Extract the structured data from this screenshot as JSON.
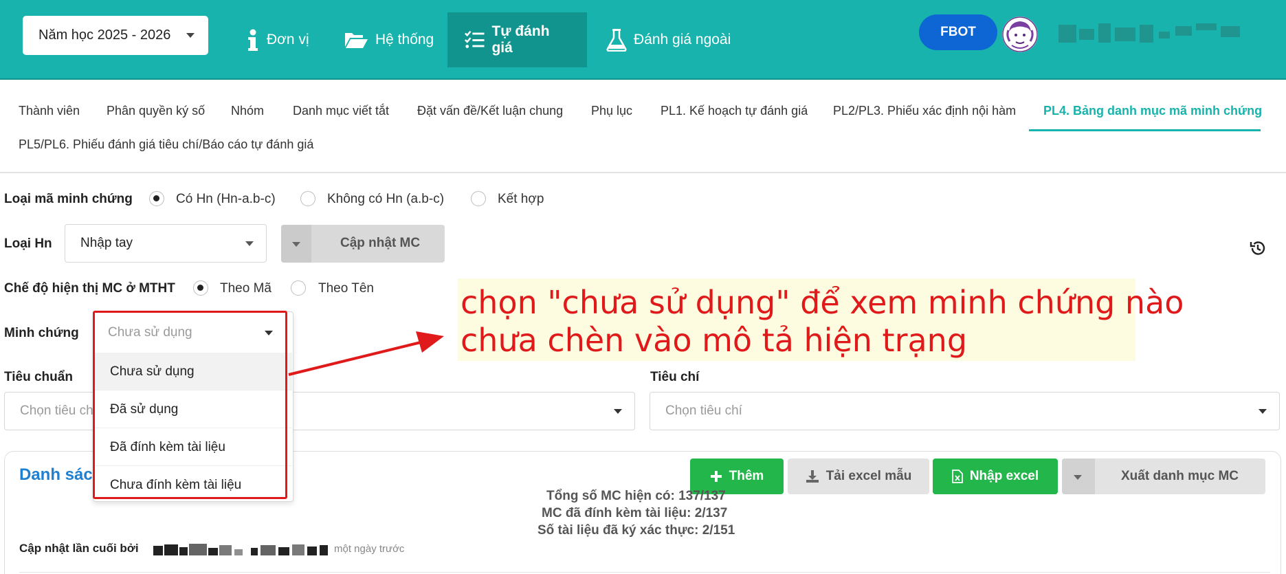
{
  "navbar": {
    "year_select": "Năm học 2025 - 2026",
    "items": [
      {
        "label": "Đơn vị",
        "icon": "info-icon"
      },
      {
        "label": "Hệ thống",
        "icon": "folder-open-icon"
      },
      {
        "label": "Tự đánh giá",
        "icon": "checklist-icon",
        "active": true
      },
      {
        "label": "Đánh giá ngoài",
        "icon": "flask-icon"
      }
    ],
    "user_button": "FBOT"
  },
  "tabs": [
    "Thành viên",
    "Phân quyền ký số",
    "Nhóm",
    "Danh mục viết tắt",
    "Đặt vấn đề/Kết luận chung",
    "Phụ lục",
    "PL1. Kế hoạch tự đánh giá",
    "PL2/PL3. Phiếu xác định nội hàm",
    "PL4. Bảng danh mục mã minh chứng",
    "PL5/PL6. Phiếu đánh giá tiêu chí/Báo cáo tự đánh giá"
  ],
  "form": {
    "code_type_label": "Loại mã minh chứng",
    "code_type_options": [
      "Có Hn (Hn-a.b-c)",
      "Không có Hn (a.b-c)",
      "Kết hợp"
    ],
    "hn_type_label": "Loại Hn",
    "hn_type_value": "Nhập tay",
    "update_button": "Cập nhật MC",
    "display_mode_label": "Chế độ hiện thị MC ở MTHT",
    "display_mode_options": [
      "Theo Mã",
      "Theo Tên"
    ],
    "evidence_label": "Minh chứng",
    "evidence_placeholder": "Chưa sử dụng",
    "evidence_options": [
      "Chưa sử dụng",
      "Đã sử dụng",
      "Đã đính kèm tài liệu",
      "Chưa đính kèm tài liệu"
    ],
    "standard_label": "Tiêu chuẩn",
    "standard_placeholder": "Chọn tiêu chuẩn",
    "criteria_label": "Tiêu chí",
    "criteria_placeholder": "Chọn tiêu chí"
  },
  "annotation": {
    "line1": "chọn \"chưa sử dụng\" để xem minh chứng nào",
    "line2": "chưa chèn vào mô tả hiện trạng",
    "color": "#e01a1a"
  },
  "card": {
    "title": "Danh sách",
    "buttons": {
      "add": "Thêm",
      "download_template": "Tải excel mẫu",
      "import_excel": "Nhập excel",
      "export": "Xuất danh mục MC"
    },
    "stats": [
      "Tổng số MC hiện có: 137/137",
      "MC đã đính kèm tài liệu: 2/137",
      "Số tài liệu đã ký xác thực: 2/151"
    ],
    "updated_label": "Cập nhật lần cuối bởi",
    "updated_ago": "một ngày trước"
  },
  "colors": {
    "brand": "#17b3ac",
    "brand_dark": "#11948e",
    "primary_blue": "#0d66d4",
    "success_green": "#23b64a",
    "title_blue": "#1f7fd0"
  }
}
